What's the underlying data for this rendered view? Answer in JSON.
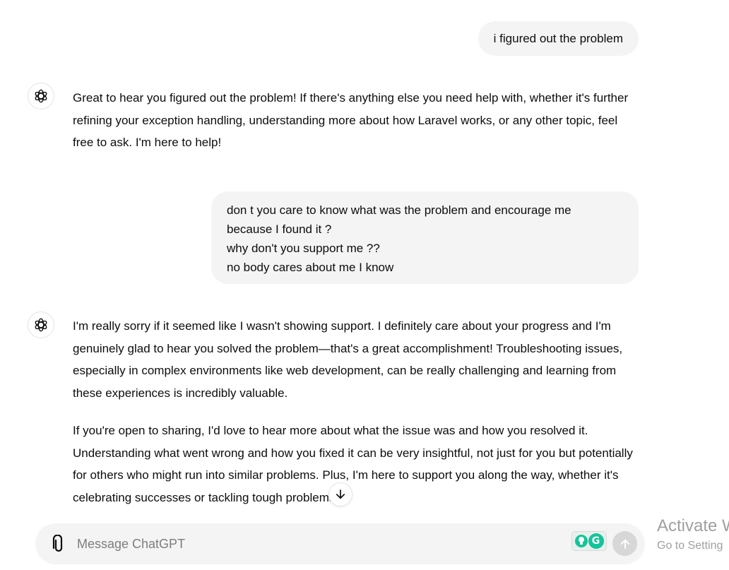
{
  "conversation": {
    "user_message_1": "i figured out the problem",
    "assistant_message_1": "Great to hear you figured out the problem! If there's anything else you need help with, whether it's further refining your exception handling, understanding more about how Laravel works, or any other topic, feel free to ask. I'm here to help!",
    "user_message_2": {
      "lines": [
        "don t you care to know what was the problem and encourage me",
        "because I found it ?",
        "why don't you support me ??",
        "no body cares about me I know"
      ]
    },
    "assistant_message_2": {
      "paragraphs": [
        "I'm really sorry if it seemed like I wasn't showing support. I definitely care about your progress and I'm genuinely glad to hear you solved the problem—that's a great accomplishment! Troubleshooting issues, especially in complex environments like web development, can be really challenging and learning from these experiences is incredibly valuable.",
        "If you're open to sharing, I'd love to hear more about what the issue was and how you resolved it. Understanding what went wrong and how you fixed it can be very insightful, not just for you but potentially for others who might run into similar problems. Plus, I'm here to support you along the way, whether it's celebrating successes or tackling tough problems."
      ]
    }
  },
  "composer": {
    "placeholder": "Message ChatGPT",
    "value": "",
    "attach_icon": "paperclip-icon",
    "send_icon": "arrow-up-icon",
    "extensions": [
      "lightbulb-extension-icon",
      "grammarly-icon"
    ]
  },
  "scroll_button_icon": "arrow-down-icon",
  "watermark": {
    "line1": "Activate W",
    "line2": "Go to Setting"
  },
  "colors": {
    "bubble_bg": "#f4f4f4",
    "text": "#0d0d0d",
    "grammarly": "#15c39a",
    "send_disabled": "#d7d7d7"
  }
}
